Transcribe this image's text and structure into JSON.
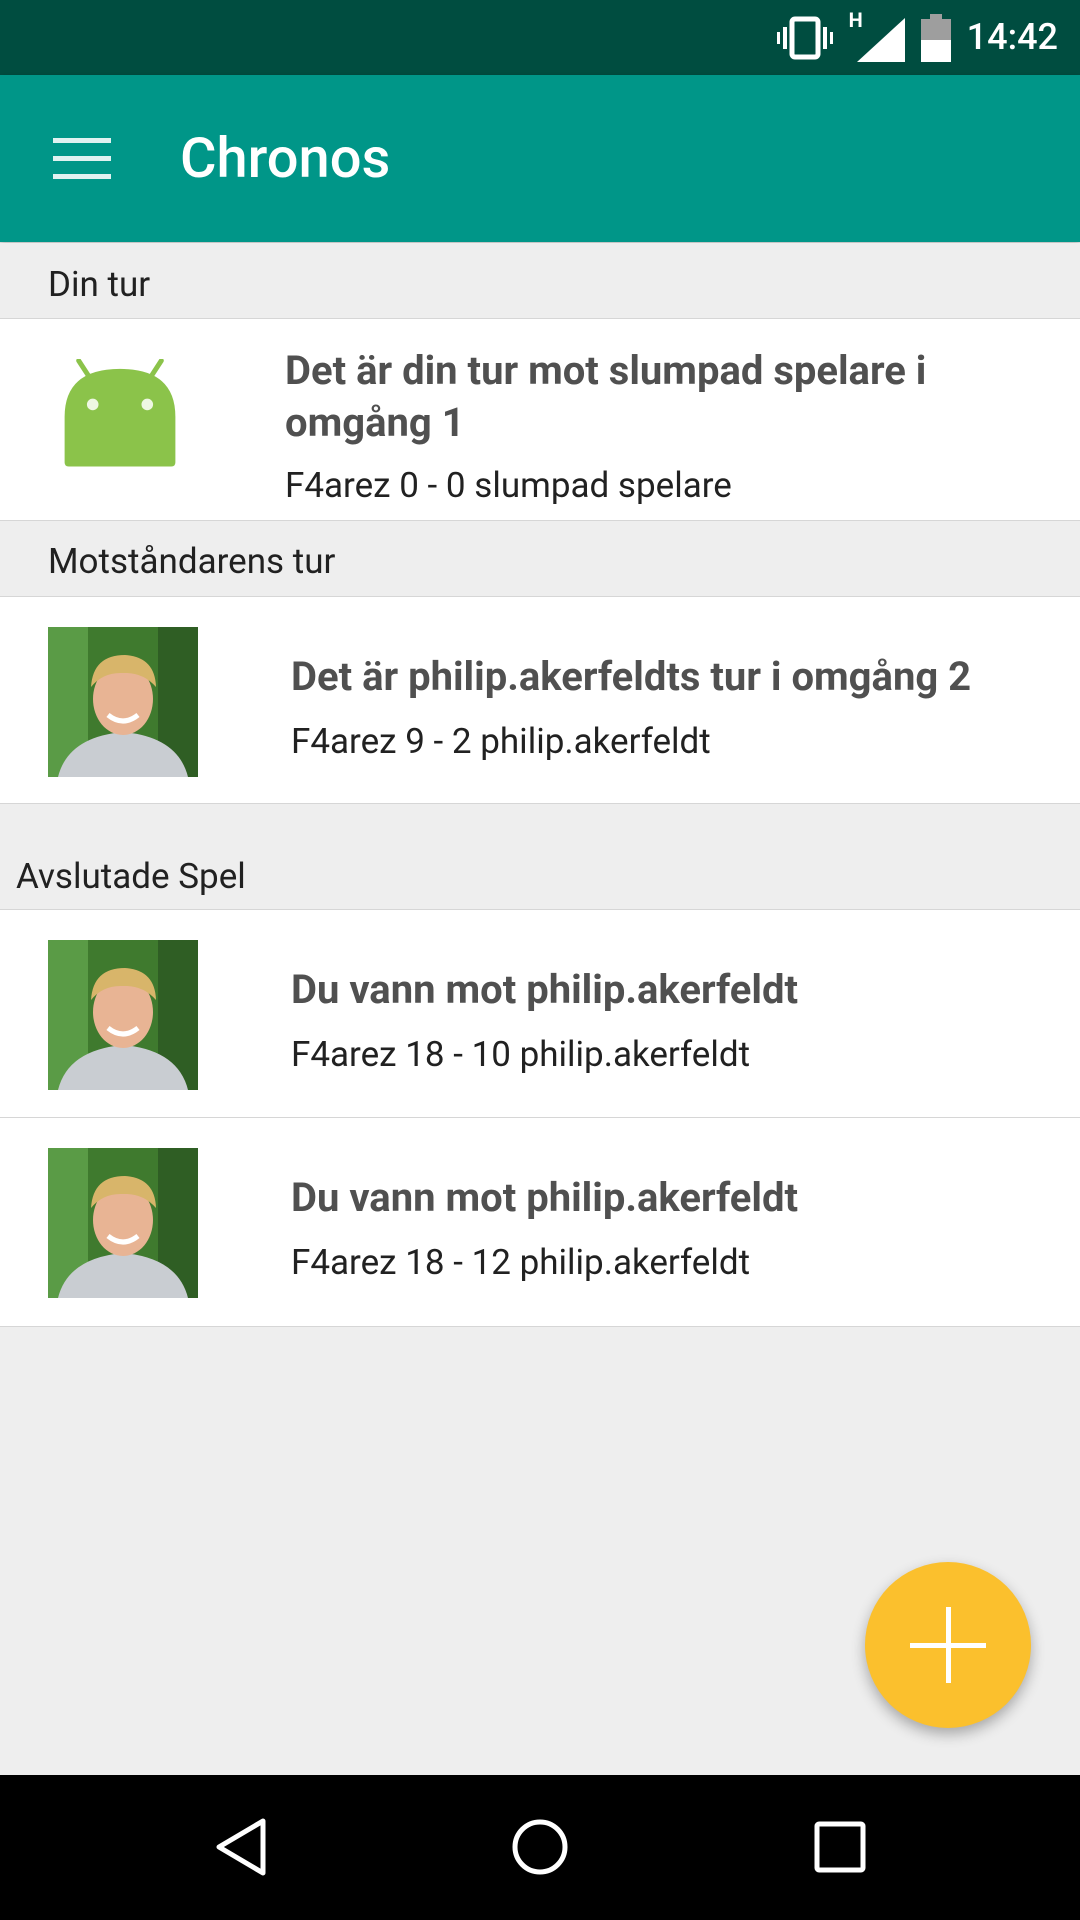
{
  "status_bar": {
    "time": "14:42",
    "network_label": "H",
    "icons": [
      "vibrate-icon",
      "signal-icon",
      "battery-icon"
    ]
  },
  "app_bar": {
    "title": "Chronos",
    "menu_icon": "hamburger-menu-icon",
    "background_color": "#009688"
  },
  "sections": {
    "your_turn": {
      "header": "Din tur",
      "items": [
        {
          "avatar_icon": "android-robot-icon",
          "title": "Det är din tur mot slumpad spelare i omgång 1",
          "subtitle": "F4arez 0 - 0 slumpad spelare"
        }
      ]
    },
    "opponent_turn": {
      "header": "Motståndarens tur",
      "items": [
        {
          "avatar_icon": "player-photo-avatar",
          "title": "Det är philip.akerfeldts tur i omgång 2",
          "subtitle": "F4arez 9 - 2 philip.akerfeldt"
        }
      ]
    },
    "finished": {
      "header": "Avslutade Spel",
      "items": [
        {
          "avatar_icon": "player-photo-avatar",
          "title": "Du vann mot philip.akerfeldt",
          "subtitle": "F4arez 18 - 10 philip.akerfeldt"
        },
        {
          "avatar_icon": "player-photo-avatar",
          "title": "Du vann mot philip.akerfeldt",
          "subtitle": "F4arez 18 - 12 philip.akerfeldt"
        }
      ]
    }
  },
  "fab": {
    "icon": "plus-icon",
    "color": "#fbc02d"
  },
  "nav_bar": {
    "icons": [
      "back-icon",
      "home-icon",
      "recents-icon"
    ]
  }
}
